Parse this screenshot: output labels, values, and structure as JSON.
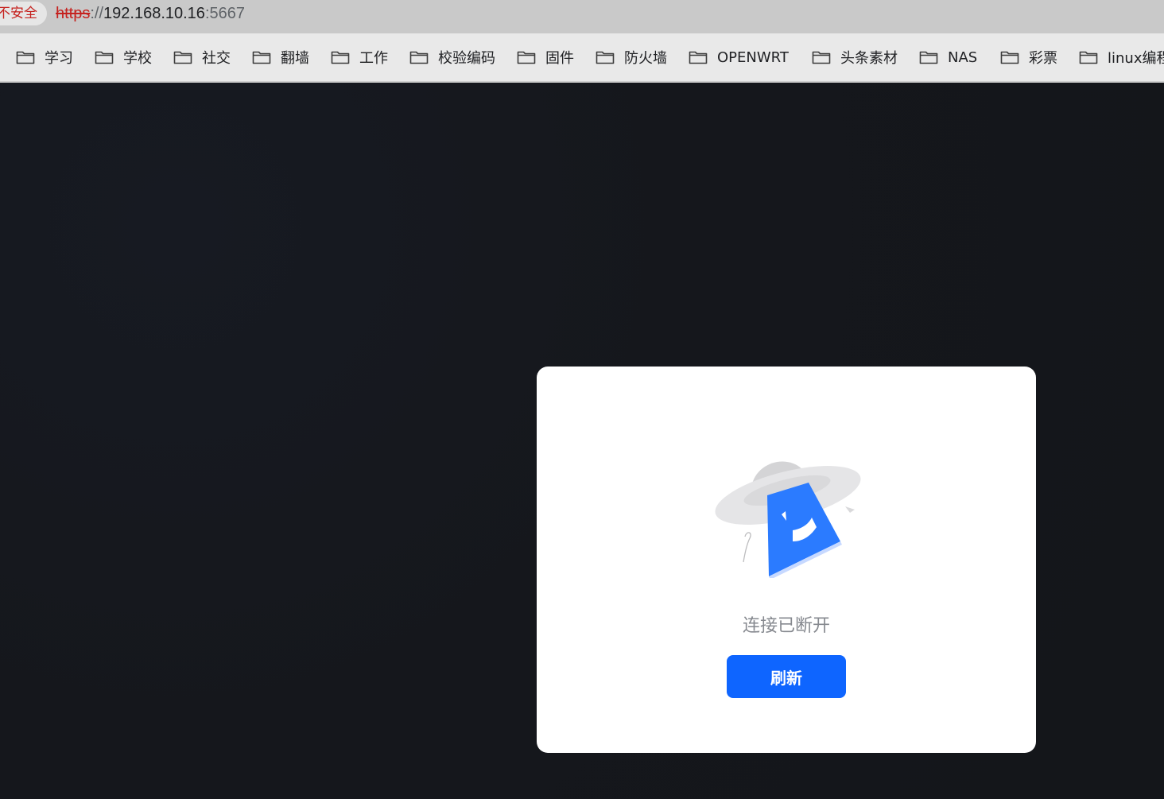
{
  "browser": {
    "security_label": "不安全",
    "url": {
      "scheme": "https",
      "separator": "://",
      "host": "192.168.10.16",
      "port": ":5667"
    },
    "bookmarks": [
      {
        "label": "学习",
        "icon": "folder-icon"
      },
      {
        "label": "学校",
        "icon": "folder-icon"
      },
      {
        "label": "社交",
        "icon": "folder-icon"
      },
      {
        "label": "翻墙",
        "icon": "folder-icon"
      },
      {
        "label": "工作",
        "icon": "folder-icon"
      },
      {
        "label": "校验编码",
        "icon": "folder-icon"
      },
      {
        "label": "固件",
        "icon": "folder-icon"
      },
      {
        "label": "防火墙",
        "icon": "folder-icon"
      },
      {
        "label": "OPENWRT",
        "icon": "folder-icon"
      },
      {
        "label": "头条素材",
        "icon": "folder-icon"
      },
      {
        "label": "NAS",
        "icon": "folder-icon"
      },
      {
        "label": "彩票",
        "icon": "folder-icon"
      },
      {
        "label": "linux编程",
        "icon": "folder-icon"
      }
    ]
  },
  "dialog": {
    "illustration": "ufo-disconnected-icon",
    "message": "连接已断开",
    "refresh_label": "刷新"
  },
  "colors": {
    "background": "#16181d",
    "dialog": "#ffffff",
    "accent": "#0e65ff",
    "insecure": "#c5221f"
  }
}
